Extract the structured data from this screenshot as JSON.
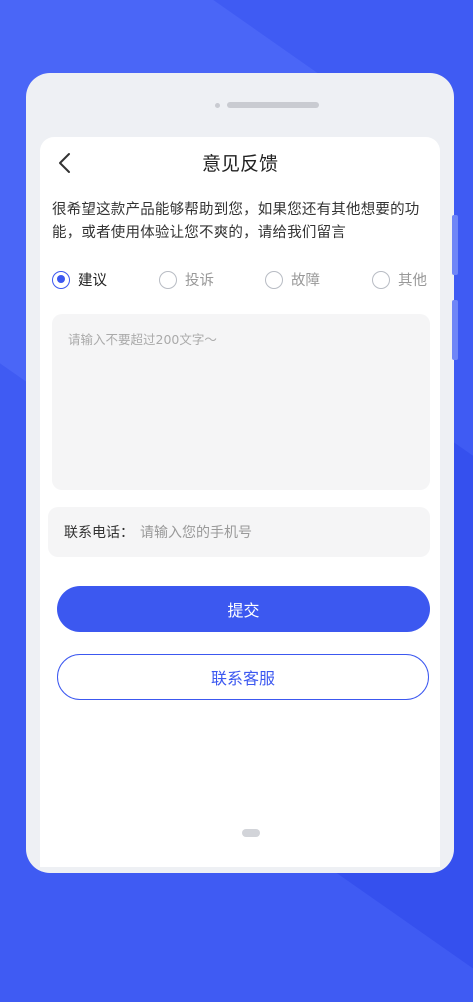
{
  "header": {
    "title": "意见反馈"
  },
  "description": "很希望这款产品能够帮助到您，如果您还有其他想要的功能，或者使用体验让您不爽的，请给我们留言",
  "feedback_types": [
    {
      "label": "建议",
      "checked": true
    },
    {
      "label": "投诉",
      "checked": false
    },
    {
      "label": "故障",
      "checked": false
    },
    {
      "label": "其他",
      "checked": false
    }
  ],
  "content_input": {
    "placeholder": "请输入不要超过200文字～"
  },
  "phone_field": {
    "label": "联系电话：",
    "placeholder": "请输入您的手机号"
  },
  "buttons": {
    "submit": "提交",
    "contact_service": "联系客服"
  },
  "colors": {
    "accent": "#3c58f0",
    "background": "#3f5bf3"
  }
}
